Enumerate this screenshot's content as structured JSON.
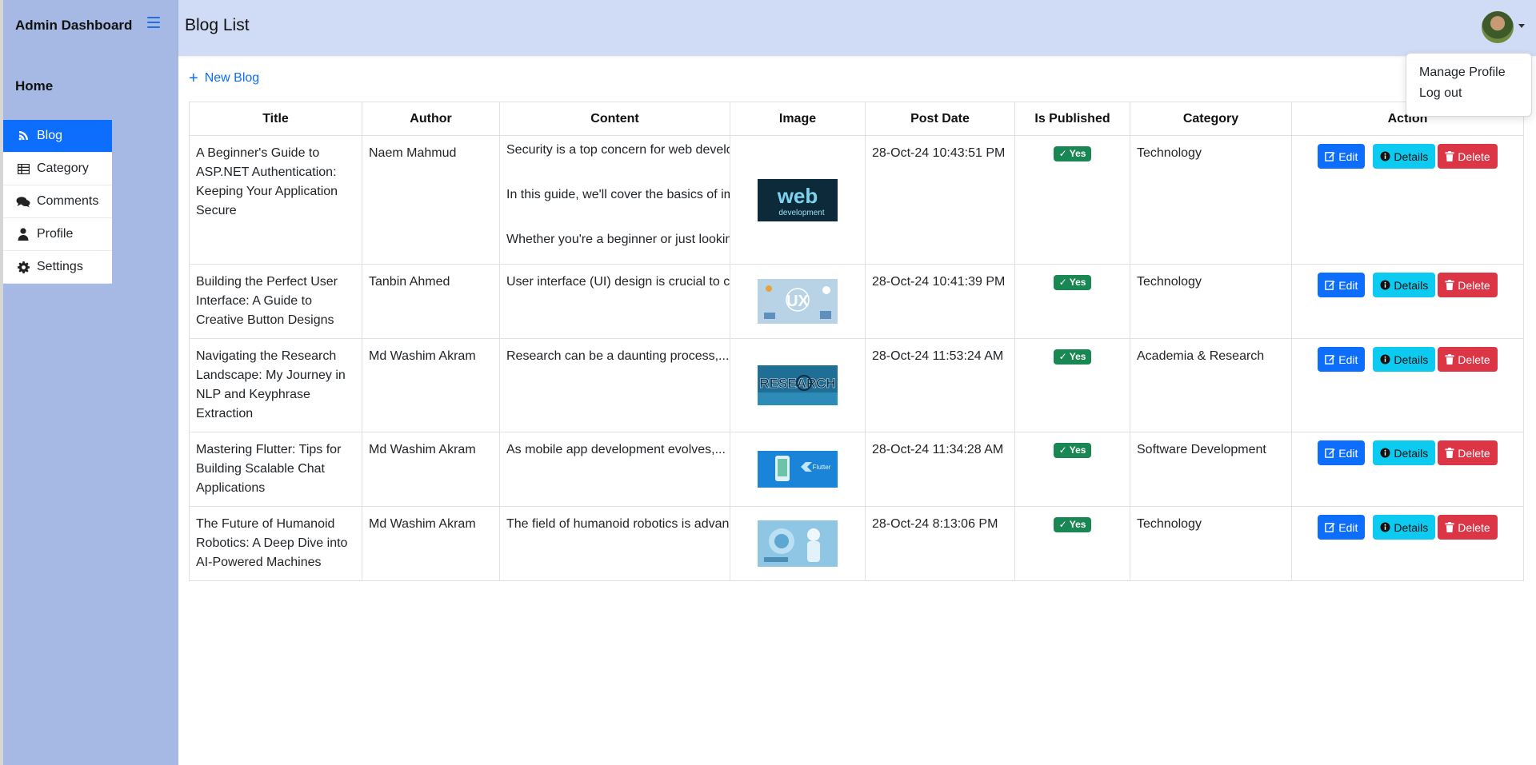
{
  "sidebar": {
    "brand": "Admin Dashboard",
    "home": "Home",
    "items": [
      {
        "label": "Blog",
        "icon": "blog-icon",
        "active": true
      },
      {
        "label": "Category",
        "icon": "table-icon",
        "active": false
      },
      {
        "label": "Comments",
        "icon": "comments-icon",
        "active": false
      },
      {
        "label": "Profile",
        "icon": "user-icon",
        "active": false
      },
      {
        "label": "Settings",
        "icon": "gear-icon",
        "active": false
      }
    ]
  },
  "header": {
    "title": "Blog List"
  },
  "profile_menu": {
    "manage": "Manage Profile",
    "logout": "Log out"
  },
  "toolbar": {
    "new_blog": "New Blog"
  },
  "table": {
    "headers": [
      "Title",
      "Author",
      "Content",
      "Image",
      "Post Date",
      "Is Published",
      "Category",
      "Action"
    ],
    "rows": [
      {
        "title": "A Beginner's Guide to ASP.NET Authentication: Keeping Your Application Secure",
        "author": "Naem Mahmud",
        "content": [
          "Security is a top concern for web develo",
          "In this guide, we'll cover the basics of im",
          "Whether you're a beginner or just lookin"
        ],
        "image": "web-development-thumbnail",
        "date": "28-Oct-24 10:43:51 PM",
        "published": "Yes",
        "category": "Technology"
      },
      {
        "title": "Building the Perfect User Interface: A Guide to Creative Button Designs",
        "author": "Tanbin Ahmed",
        "content": [
          "User interface (UI) design is crucial to cr"
        ],
        "image": "ux-thumbnail",
        "date": "28-Oct-24 10:41:39 PM",
        "published": "Yes",
        "category": "Technology"
      },
      {
        "title": "Navigating the Research Landscape: My Journey in NLP and Keyphrase Extraction",
        "author": "Md Washim Akram",
        "content": [
          "Research can be a daunting process,..."
        ],
        "image": "research-thumbnail",
        "date": "28-Oct-24 11:53:24 AM",
        "published": "Yes",
        "category": "Academia & Research"
      },
      {
        "title": "Mastering Flutter: Tips for Building Scalable Chat Applications",
        "author": "Md Washim Akram",
        "content": [
          "As mobile app development evolves,..."
        ],
        "image": "flutter-thumbnail",
        "date": "28-Oct-24 11:34:28 AM",
        "published": "Yes",
        "category": "Software Development"
      },
      {
        "title": "The Future of Humanoid Robotics: A Deep Dive into AI-Powered Machines",
        "author": "Md Washim Akram",
        "content": [
          "The field of humanoid robotics is advan"
        ],
        "image": "robotics-thumbnail",
        "date": "28-Oct-24 8:13:06 PM",
        "published": "Yes",
        "category": "Technology"
      }
    ],
    "actions": {
      "edit": "Edit",
      "details": "Details",
      "delete": "Delete"
    }
  },
  "colors": {
    "primary": "#0d6efd",
    "info": "#0dcaf0",
    "danger": "#dc3545",
    "success": "#198754",
    "sidebar": "#a5b9e4",
    "header": "#d0dcf5"
  }
}
